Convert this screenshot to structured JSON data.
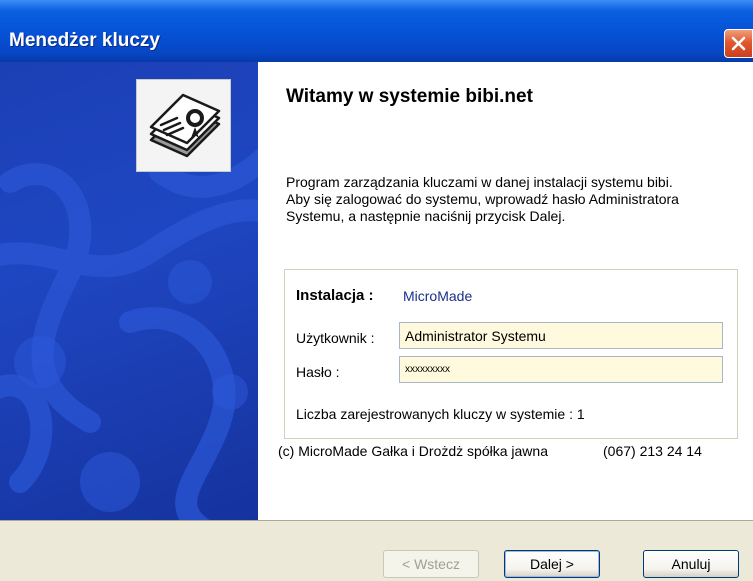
{
  "window": {
    "title": "Menedżer kluczy",
    "close_icon": "close-icon"
  },
  "side_panel": {
    "logo_icon": "key-certificates-icon"
  },
  "main": {
    "heading": "Witamy w systemie bibi.net",
    "intro_lines": [
      "Program  zarządzania  kluczami w danej  instalacji systemu bibi.",
      "Aby się zalogować do systemu, wprowadź hasło Administratora",
      "Systemu, a następnie naciśnij przycisk Dalej."
    ],
    "installation": {
      "label": "Instalacja :",
      "value": "MicroMade"
    },
    "user": {
      "label": "Użytkownik :",
      "value": "Administrator Systemu"
    },
    "password": {
      "label": "Hasło :",
      "value": "xxxxxxxxx"
    },
    "key_count_text": "Liczba zarejestrowanych kluczy w systemie : 1",
    "copyright": "(c) MicroMade Gałka i Drożdż spółka jawna",
    "phone": "(067) 213 24 14"
  },
  "buttons": {
    "back": "< Wstecz",
    "next": "Dalej >",
    "cancel": "Anuluj"
  },
  "colors": {
    "titlebar": "#0551d6",
    "side_panel": "#1f46c2",
    "input_background": "#fff9dd",
    "installation_value": "#1a2f8a"
  }
}
